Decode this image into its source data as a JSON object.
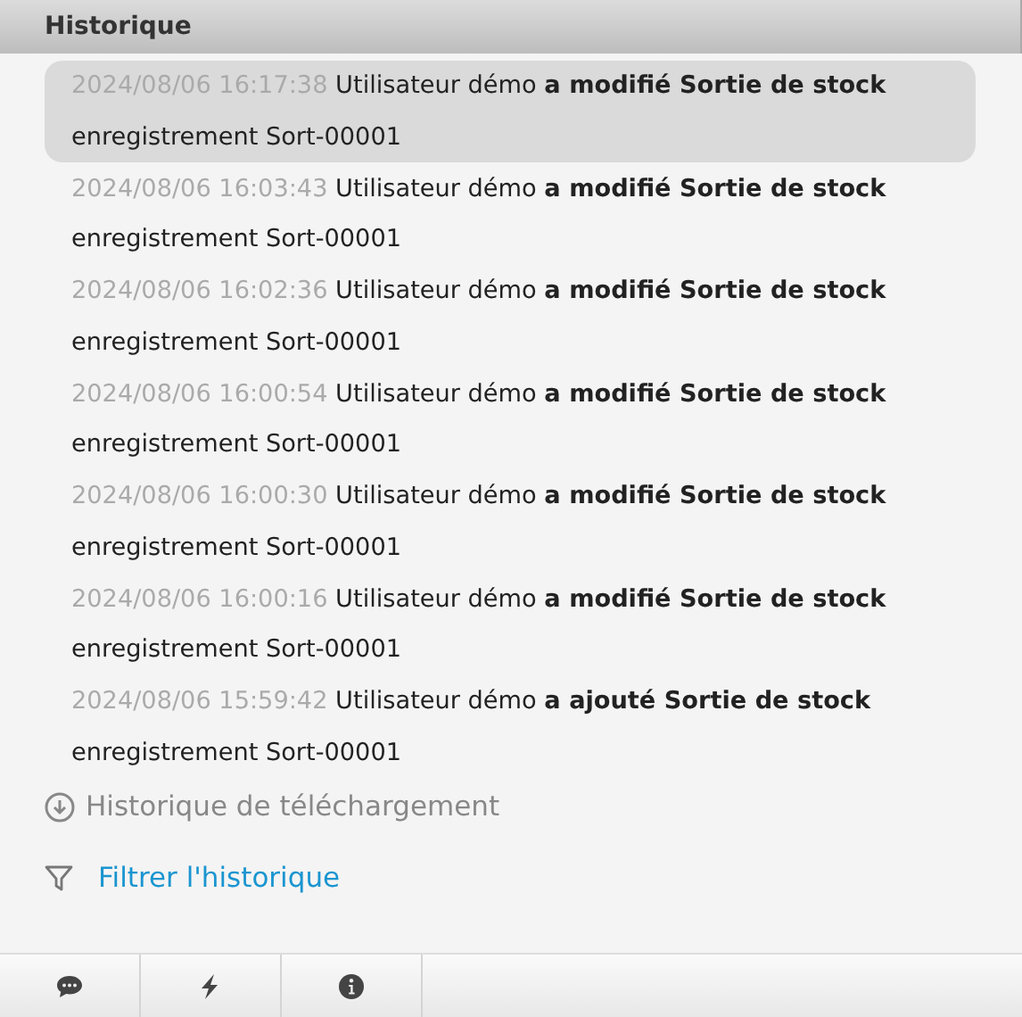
{
  "panel": {
    "title": "Historique"
  },
  "history": [
    {
      "time": "2024/08/06 16:17:38",
      "user": "Utilisateur démo",
      "action": "a modifié Sortie de stock",
      "record": "enregistrement Sort-00001",
      "selected": true
    },
    {
      "time": "2024/08/06 16:03:43",
      "user": "Utilisateur démo",
      "action": "a modifié Sortie de stock",
      "record": "enregistrement Sort-00001",
      "selected": false
    },
    {
      "time": "2024/08/06 16:02:36",
      "user": "Utilisateur démo",
      "action": "a modifié Sortie de stock",
      "record": "enregistrement Sort-00001",
      "selected": false
    },
    {
      "time": "2024/08/06 16:00:54",
      "user": "Utilisateur démo",
      "action": "a modifié Sortie de stock",
      "record": "enregistrement Sort-00001",
      "selected": false
    },
    {
      "time": "2024/08/06 16:00:30",
      "user": "Utilisateur démo",
      "action": "a modifié Sortie de stock",
      "record": "enregistrement Sort-00001",
      "selected": false
    },
    {
      "time": "2024/08/06 16:00:16",
      "user": "Utilisateur démo",
      "action": "a modifié Sortie de stock",
      "record": "enregistrement Sort-00001",
      "selected": false
    },
    {
      "time": "2024/08/06 15:59:42",
      "user": "Utilisateur démo",
      "action": "a ajouté Sortie de stock",
      "record": "enregistrement Sort-00001",
      "selected": false
    }
  ],
  "download": {
    "label": "Historique de téléchargement"
  },
  "filter": {
    "label": "Filtrer l'historique"
  },
  "bottom_tabs": [
    {
      "kind": "comments"
    },
    {
      "kind": "activity"
    },
    {
      "kind": "info"
    }
  ]
}
